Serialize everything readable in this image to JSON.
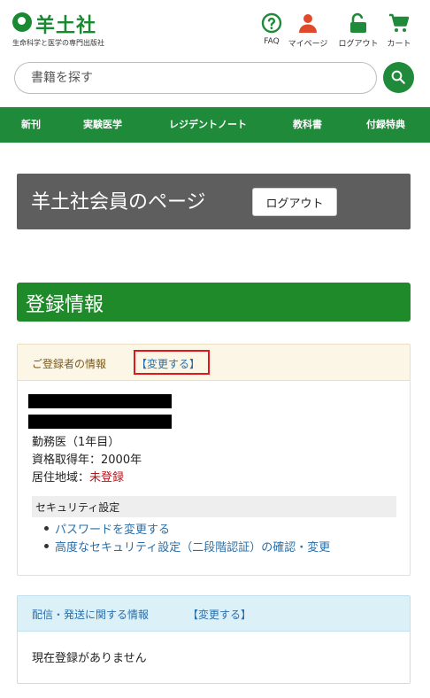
{
  "header": {
    "logo_text": "羊土社",
    "logo_tagline": "生命科学と医学の専門出版社",
    "util_links": [
      {
        "label": "FAQ",
        "icon": "question-circle-icon",
        "color": "#1e8a3a"
      },
      {
        "label": "マイページ",
        "icon": "user-icon",
        "color": "#e04a2a"
      },
      {
        "label": "ログアウト",
        "icon": "unlock-icon",
        "color": "#1e8a3a"
      },
      {
        "label": "カート",
        "icon": "cart-icon",
        "color": "#1e8a3a"
      }
    ]
  },
  "search": {
    "placeholder": "書籍を探す",
    "button_icon": "search-icon"
  },
  "nav": {
    "items": [
      "新刊",
      "実験医学",
      "レジデントノート",
      "教科書",
      "付録特典"
    ]
  },
  "member": {
    "title": "羊土社会員のページ",
    "logout_label": "ログアウト"
  },
  "section": {
    "title": "登録情報"
  },
  "registrant": {
    "title": "ご登録者の情報",
    "change_label": "【変更する】",
    "info_lines": [
      "勤務医（1年目）",
      "資格取得年：2000年"
    ],
    "residence_label": "居住地域：",
    "residence_value": "未登録",
    "security_title": "セキュリティ設定",
    "security_links": [
      "パスワードを変更する",
      "高度なセキュリティ設定（二段階認証）の確認・変更"
    ]
  },
  "delivery": {
    "title": "配信・発送に関する情報",
    "change_label": "【変更する】",
    "body": "現在登録がありません"
  },
  "colors": {
    "brand_green": "#1e8a3a",
    "highlight_red": "#e3161b",
    "link_blue": "#2a6fa8"
  }
}
